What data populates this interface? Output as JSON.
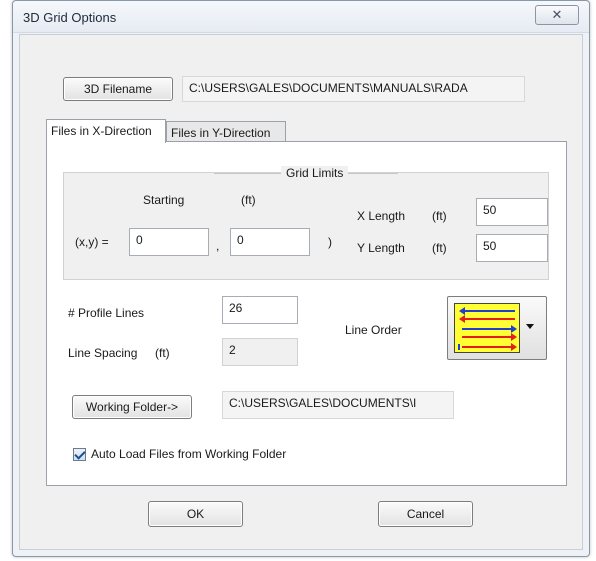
{
  "window": {
    "title": "3D Grid Options",
    "close_glyph": "✕"
  },
  "filename": {
    "button_label": "3D Filename",
    "path": "C:\\USERS\\GALES\\DOCUMENTS\\MANUALS\\RADA"
  },
  "tabs": [
    {
      "label": "Files in X-Direction",
      "active": true
    },
    {
      "label": "Files in Y-Direction",
      "active": false
    }
  ],
  "grid_limits": {
    "caption": "Grid Limits",
    "starting_label": "Starting",
    "unit_ft": "(ft)",
    "xy_label": "(x,y) =",
    "x_value": "0",
    "comma": ",",
    "y_value": "0",
    "close_paren": ")",
    "x_length_label": "X Length",
    "x_length_value": "50",
    "y_length_label": "Y Length",
    "y_length_value": "50"
  },
  "profile": {
    "lines_label": "# Profile Lines",
    "lines_value": "26",
    "spacing_label": "Line Spacing",
    "spacing_unit": "(ft)",
    "spacing_value": "2",
    "line_order_label": "Line Order",
    "line_order_icon": "line-order-arrows-icon"
  },
  "working_folder": {
    "button_label": "Working Folder->",
    "path": "C:\\USERS\\GALES\\DOCUMENTS\\I"
  },
  "auto_load": {
    "label": "Auto Load Files from Working Folder",
    "checked": true
  },
  "footer": {
    "ok_label": "OK",
    "cancel_label": "Cancel"
  },
  "colors": {
    "swatch_bg": "#ffff33",
    "arrow_red": "#e02020",
    "arrow_blue": "#1f3fd0"
  }
}
